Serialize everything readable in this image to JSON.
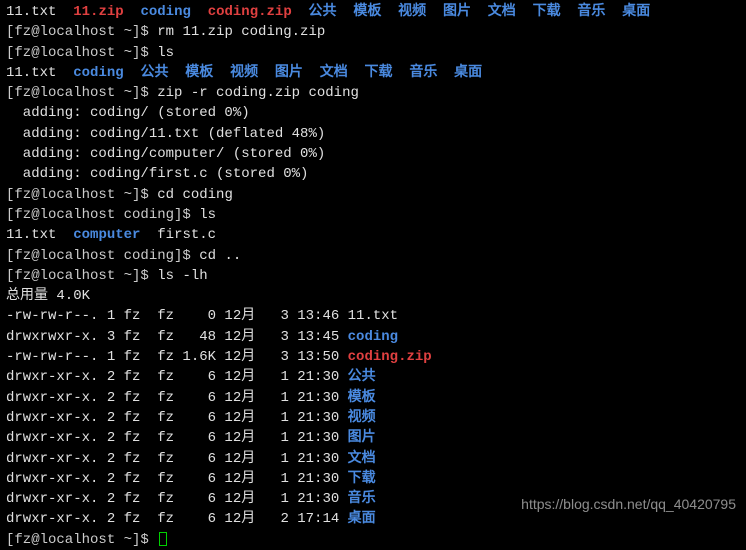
{
  "ls1": {
    "f1": "11.txt",
    "f2": "11.zip",
    "f3": "coding",
    "f4": "coding.zip",
    "d1": "公共",
    "d2": "模板",
    "d3": "视频",
    "d4": "图片",
    "d5": "文档",
    "d6": "下载",
    "d7": "音乐",
    "d8": "桌面"
  },
  "prompts": {
    "home": "[fz@localhost ~]$ ",
    "coding": "[fz@localhost coding]$ "
  },
  "cmds": {
    "rm": "rm 11.zip coding.zip",
    "ls": "ls",
    "zip": "zip -r coding.zip coding",
    "cdcoding": "cd coding",
    "cdup": "cd ..",
    "lslh": "ls -lh"
  },
  "ls2": {
    "f1": "11.txt",
    "f3": "coding",
    "d1": "公共",
    "d2": "模板",
    "d3": "视频",
    "d4": "图片",
    "d5": "文档",
    "d6": "下载",
    "d7": "音乐",
    "d8": "桌面"
  },
  "zip_out": {
    "l1": "  adding: coding/ (stored 0%)",
    "l2": "  adding: coding/11.txt (deflated 48%)",
    "l3": "  adding: coding/computer/ (stored 0%)",
    "l4": "  adding: coding/first.c (stored 0%)"
  },
  "ls3": {
    "f1": "11.txt",
    "f2": "computer",
    "f3": "first.c"
  },
  "total": "总用量 4.0K",
  "rows": [
    {
      "perm": "-rw-rw-r--.",
      "n": "1",
      "u": "fz",
      "g": "fz",
      "sz": "   0",
      "m": "12月",
      "d": "  3",
      "t": "13:46",
      "name": "11.txt",
      "color": "white"
    },
    {
      "perm": "drwxrwxr-x.",
      "n": "3",
      "u": "fz",
      "g": "fz",
      "sz": "  48",
      "m": "12月",
      "d": "  3",
      "t": "13:45",
      "name": "coding",
      "color": "blue"
    },
    {
      "perm": "-rw-rw-r--.",
      "n": "1",
      "u": "fz",
      "g": "fz",
      "sz": "1.6K",
      "m": "12月",
      "d": "  3",
      "t": "13:50",
      "name": "coding.zip",
      "color": "red"
    },
    {
      "perm": "drwxr-xr-x.",
      "n": "2",
      "u": "fz",
      "g": "fz",
      "sz": "   6",
      "m": "12月",
      "d": "  1",
      "t": "21:30",
      "name": "公共",
      "color": "blue"
    },
    {
      "perm": "drwxr-xr-x.",
      "n": "2",
      "u": "fz",
      "g": "fz",
      "sz": "   6",
      "m": "12月",
      "d": "  1",
      "t": "21:30",
      "name": "模板",
      "color": "blue"
    },
    {
      "perm": "drwxr-xr-x.",
      "n": "2",
      "u": "fz",
      "g": "fz",
      "sz": "   6",
      "m": "12月",
      "d": "  1",
      "t": "21:30",
      "name": "视频",
      "color": "blue"
    },
    {
      "perm": "drwxr-xr-x.",
      "n": "2",
      "u": "fz",
      "g": "fz",
      "sz": "   6",
      "m": "12月",
      "d": "  1",
      "t": "21:30",
      "name": "图片",
      "color": "blue"
    },
    {
      "perm": "drwxr-xr-x.",
      "n": "2",
      "u": "fz",
      "g": "fz",
      "sz": "   6",
      "m": "12月",
      "d": "  1",
      "t": "21:30",
      "name": "文档",
      "color": "blue"
    },
    {
      "perm": "drwxr-xr-x.",
      "n": "2",
      "u": "fz",
      "g": "fz",
      "sz": "   6",
      "m": "12月",
      "d": "  1",
      "t": "21:30",
      "name": "下载",
      "color": "blue"
    },
    {
      "perm": "drwxr-xr-x.",
      "n": "2",
      "u": "fz",
      "g": "fz",
      "sz": "   6",
      "m": "12月",
      "d": "  1",
      "t": "21:30",
      "name": "音乐",
      "color": "blue"
    },
    {
      "perm": "drwxr-xr-x.",
      "n": "2",
      "u": "fz",
      "g": "fz",
      "sz": "   6",
      "m": "12月",
      "d": "  2",
      "t": "17:14",
      "name": "桌面",
      "color": "blue"
    }
  ],
  "watermark": "https://blog.csdn.net/qq_40420795"
}
